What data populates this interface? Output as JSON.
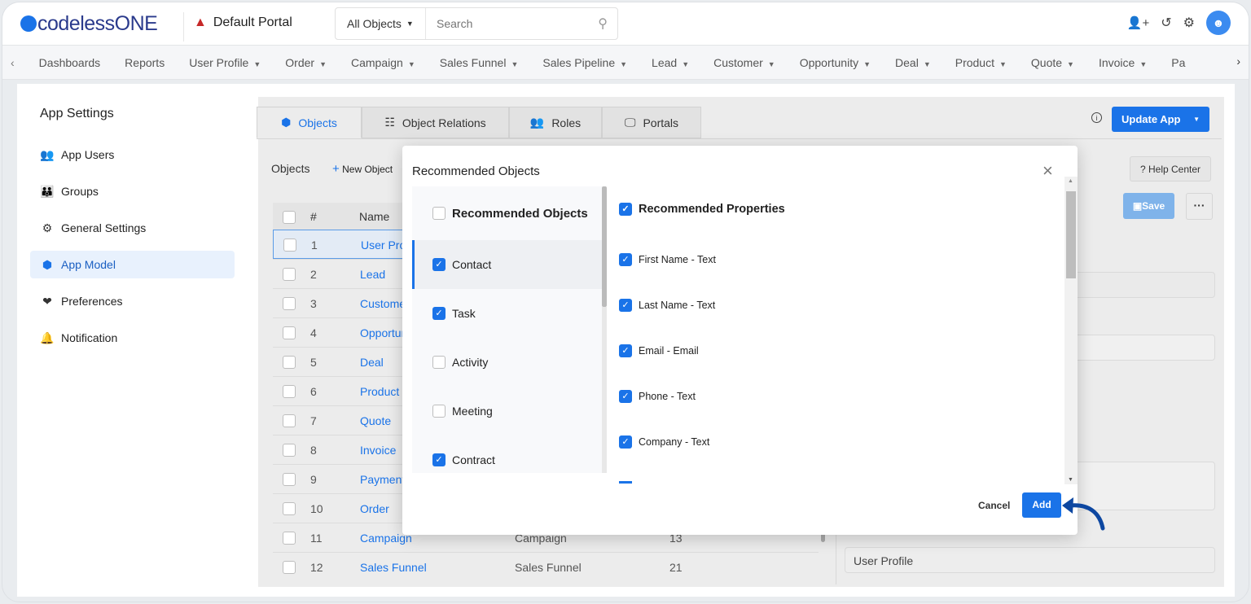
{
  "header": {
    "logo": "codelessONE",
    "portal": "Default Portal",
    "search_scope": "All Objects",
    "search_placeholder": "Search"
  },
  "nav": {
    "items": [
      {
        "label": "Dashboards",
        "dd": false
      },
      {
        "label": "Reports",
        "dd": false
      },
      {
        "label": "User Profile",
        "dd": true
      },
      {
        "label": "Order",
        "dd": true
      },
      {
        "label": "Campaign",
        "dd": true
      },
      {
        "label": "Sales Funnel",
        "dd": true
      },
      {
        "label": "Sales Pipeline",
        "dd": true
      },
      {
        "label": "Lead",
        "dd": true
      },
      {
        "label": "Customer",
        "dd": true
      },
      {
        "label": "Opportunity",
        "dd": true
      },
      {
        "label": "Deal",
        "dd": true
      },
      {
        "label": "Product",
        "dd": true
      },
      {
        "label": "Quote",
        "dd": true
      },
      {
        "label": "Invoice",
        "dd": true
      },
      {
        "label": "Pa",
        "dd": false
      }
    ]
  },
  "sidebar": {
    "title": "App Settings",
    "items": [
      {
        "label": "App Users",
        "icon": "users-icon"
      },
      {
        "label": "Groups",
        "icon": "groups-icon"
      },
      {
        "label": "General Settings",
        "icon": "gear-icon"
      },
      {
        "label": "App Model",
        "icon": "cube-icon",
        "active": true
      },
      {
        "label": "Preferences",
        "icon": "hand-heart-icon"
      },
      {
        "label": "Notification",
        "icon": "bell-icon"
      }
    ]
  },
  "tabs": [
    {
      "label": "Objects"
    },
    {
      "label": "Object Relations"
    },
    {
      "label": "Roles"
    },
    {
      "label": "Portals"
    }
  ],
  "toolbar": {
    "update_app": "Update App",
    "objects_label": "Objects",
    "new_object": "New Object",
    "help_center": "Help Center",
    "save": "Save"
  },
  "table": {
    "headers": {
      "num": "#",
      "name": "Name"
    },
    "rows": [
      {
        "n": "1",
        "name": "User Profile",
        "label": "",
        "count": ""
      },
      {
        "n": "2",
        "name": "Lead",
        "label": "",
        "count": ""
      },
      {
        "n": "3",
        "name": "Customer",
        "label": "",
        "count": ""
      },
      {
        "n": "4",
        "name": "Opportunity",
        "label": "",
        "count": ""
      },
      {
        "n": "5",
        "name": "Deal",
        "label": "",
        "count": ""
      },
      {
        "n": "6",
        "name": "Product",
        "label": "",
        "count": ""
      },
      {
        "n": "7",
        "name": "Quote",
        "label": "",
        "count": ""
      },
      {
        "n": "8",
        "name": "Invoice",
        "label": "",
        "count": ""
      },
      {
        "n": "9",
        "name": "Payment",
        "label": "",
        "count": ""
      },
      {
        "n": "10",
        "name": "Order",
        "label": "",
        "count": ""
      },
      {
        "n": "11",
        "name": "Campaign",
        "label": "Campaign",
        "count": "13"
      },
      {
        "n": "12",
        "name": "Sales Funnel",
        "label": "Sales Funnel",
        "count": "21"
      }
    ]
  },
  "right_field_value": "User Profile",
  "modal": {
    "title": "Recommended Objects",
    "objects_header": "Recommended Objects",
    "properties_header": "Recommended Properties",
    "objects": [
      {
        "label": "Contact",
        "checked": true,
        "active": true
      },
      {
        "label": "Task",
        "checked": true
      },
      {
        "label": "Activity",
        "checked": false
      },
      {
        "label": "Meeting",
        "checked": false
      },
      {
        "label": "Contract",
        "checked": true
      }
    ],
    "properties": [
      {
        "label": "First Name - Text",
        "checked": true
      },
      {
        "label": "Last Name - Text",
        "checked": true
      },
      {
        "label": "Email - Email",
        "checked": true
      },
      {
        "label": "Phone - Text",
        "checked": true
      },
      {
        "label": "Company - Text",
        "checked": true
      }
    ],
    "cancel": "Cancel",
    "add": "Add"
  },
  "colors": {
    "accent": "#1a73e8",
    "arrow": "#0d47a1"
  }
}
